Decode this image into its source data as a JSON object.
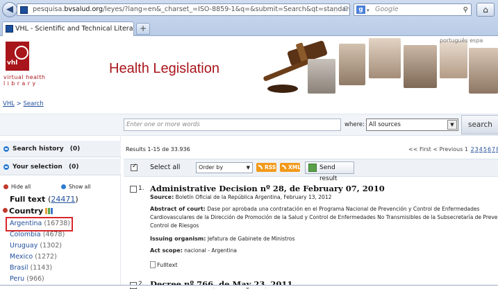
{
  "browser": {
    "url_prefix": "pesquisa.",
    "url_domain": "bvsalud.org",
    "url_rest": "/leyes/?lang=en&_charset_=ISO-8859-1&q=&submit=Search&qt=standard",
    "search_engine_placeholder": "Google",
    "tab_title": "VHL - Scientific and Technical Literature",
    "new_tab": "+"
  },
  "header": {
    "logo_abbrev": "vhl",
    "logo_line1": "virtual health",
    "logo_line2": "library",
    "site_title": "Health Legislation",
    "languages": "português  espa"
  },
  "breadcrumb": {
    "root": "VHL",
    "sep": " > ",
    "current": "Search"
  },
  "search": {
    "placeholder": "Enter one or more words",
    "where_label": "where:",
    "where_value": "All sources",
    "button": "search"
  },
  "sidebar": {
    "history_label": "Search history",
    "history_count": "(0)",
    "selection_label": "Your selection",
    "selection_count": "(0)",
    "hide_all": "Hide all",
    "show_all": "Show all",
    "fulltext_label": "Full text",
    "fulltext_open": "(",
    "fulltext_count": "24471",
    "fulltext_close": ")",
    "country_heading": "Country",
    "countries": [
      {
        "name": "Argentina",
        "count": "(16738)"
      },
      {
        "name": "Colombia",
        "count": "(4678)"
      },
      {
        "name": "Uruguay",
        "count": "(1302)"
      },
      {
        "name": "Mexico",
        "count": "(1272)"
      },
      {
        "name": "Brasil",
        "count": "(1143)"
      },
      {
        "name": "Peru",
        "count": "(966)"
      }
    ]
  },
  "results": {
    "summary": "Results  1-15 de 33.936",
    "pager_prefix": "<< First < Previous 1",
    "pager_pages": [
      "2",
      "3",
      "4",
      "5",
      "6",
      "7",
      "8"
    ],
    "toolbar": {
      "select_all": "Select all",
      "order_by": "Order by",
      "rss": "RSS",
      "xml": "XML",
      "send": "Send result"
    },
    "items": [
      {
        "num": "1.",
        "title": "Administrative Decision nº 28, de February 07, 2010",
        "source_label": "Source:",
        "source": " Boletín Oficial de la República Argentina, February 13, 2012",
        "abstract_label": "Abstract of court:",
        "abstract_l1": " Dase por aprobada una contratación en el Programa Nacional de Prevención y Control de Enfermedades",
        "abstract_l2": "Cardiovasculares de la Dirección de Promoción de la Salud y Control de Enfermedades No Transmisibles de la Subsecretaría de Preve",
        "abstract_l3": "Control de Riesgos",
        "organism_label": "Issuing organism:",
        "organism": " Jefatura de Gabinete de Ministros",
        "scope_label": "Act scope:",
        "scope": " nacional - Argentina",
        "fulltext": "Fulltext"
      },
      {
        "num": "2.",
        "title": "Decree nº 766, de May 23, 2011"
      }
    ]
  },
  "colors": {
    "brand_red": "#a8151b",
    "link_blue": "#1f4e9a",
    "highlight_red": "#d9242a",
    "rss_orange": "#f39a1b"
  }
}
